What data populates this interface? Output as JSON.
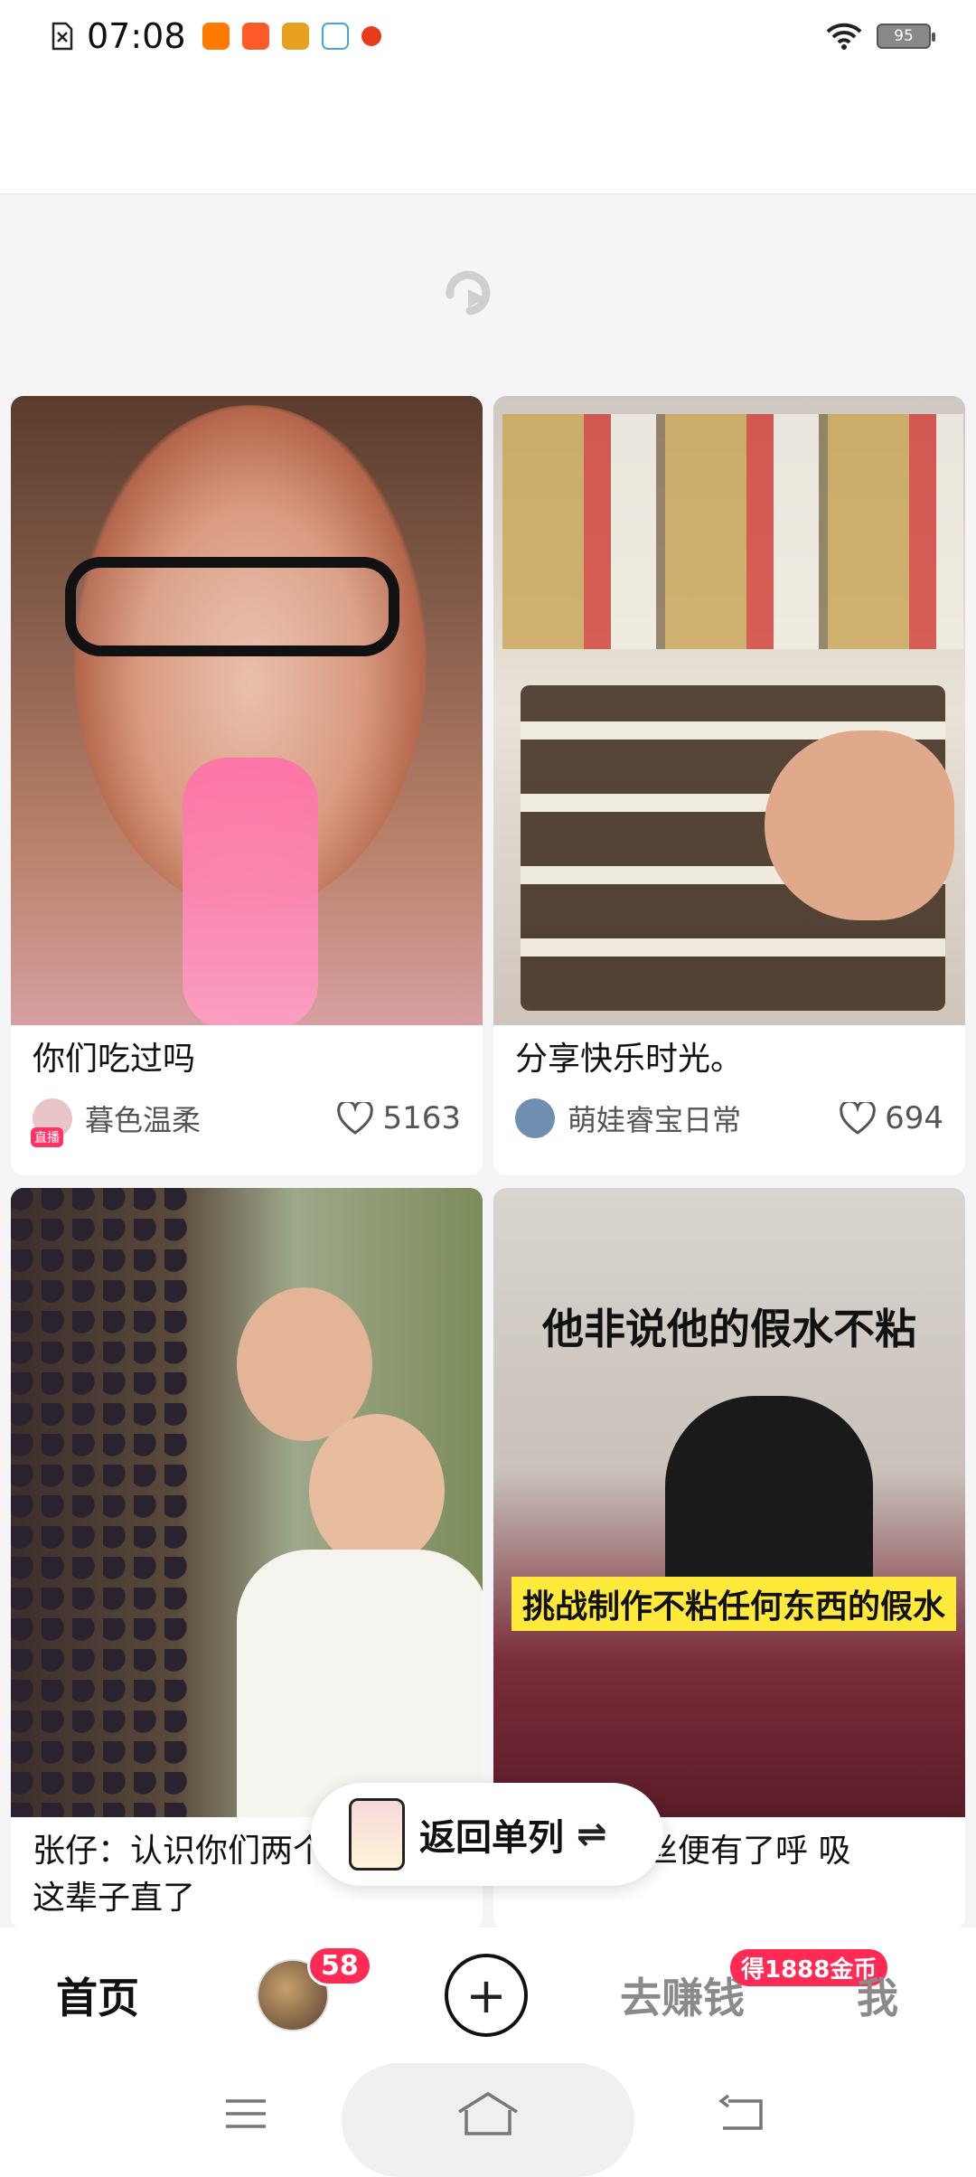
{
  "status_bar": {
    "time": "07:08",
    "battery": "95",
    "app_icons": [
      "app-icon-1",
      "app-icon-2",
      "app-icon-3",
      "app-icon-4",
      "app-icon-5"
    ]
  },
  "feed": {
    "cards": [
      {
        "caption": "你们吃过吗",
        "author": "暮色温柔",
        "likes": "5163",
        "live_badge": "直播"
      },
      {
        "caption": "分享快乐时光。",
        "author": "萌娃睿宝日常",
        "likes": "694"
      },
      {
        "caption": "张仔：认识你们两个 福气，这辈子直了"
      },
      {
        "caption": "…间，发丝便有了呼 吸",
        "overlay_top": "他非说他的假水不粘",
        "overlay_mid": "挑战制作不粘任何东西的假水"
      }
    ]
  },
  "pill": {
    "label": "返回单列",
    "swap": "⇌"
  },
  "tabbar": {
    "home": "首页",
    "friends_badge": "58",
    "post": "+",
    "earn": "去赚钱",
    "earn_badge": "得1888金币",
    "me": "我"
  },
  "colors": {
    "accent": "#ff2b55"
  }
}
